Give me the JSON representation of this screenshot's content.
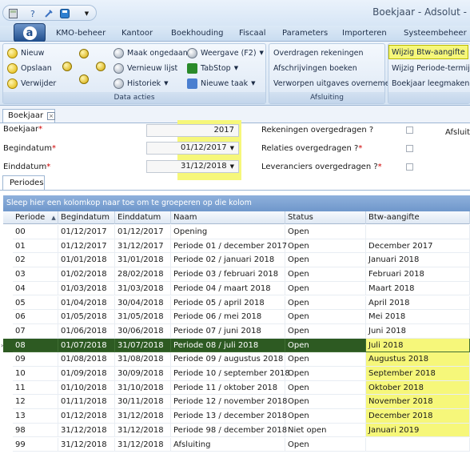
{
  "window": {
    "title": "Boekjaar - Adsolut - "
  },
  "quick_access": {
    "icons": [
      "calculator-icon",
      "help-icon",
      "tools-icon",
      "save-disk-icon"
    ]
  },
  "app_button": {
    "letter": "a"
  },
  "menu": {
    "items": [
      "KMO-beheer",
      "Kantoor",
      "Boekhouding",
      "Fiscaal",
      "Parameters",
      "Importeren",
      "Systeembeheer"
    ]
  },
  "ribbon": {
    "data_acties": {
      "label": "Data acties",
      "nieuw": "Nieuw",
      "opslaan": "Opslaan",
      "verwijder": "Verwijder",
      "maak_ongedaan": "Maak ongedaan",
      "vernieuw_lijst": "Vernieuw lijst",
      "historiek": "Historiek",
      "weergave": "Weergave (F2)",
      "tabstop": "TabStop",
      "nieuwe_taak": "Nieuwe taak"
    },
    "afsluiting": {
      "label": "Afsluiting",
      "overdragen": "Overdragen rekeningen",
      "afschrijvingen": "Afschrijvingen boeken",
      "verworpen": "Verworpen uitgaves overnemen"
    },
    "extra": {
      "wijzig_btw": "Wijzig Btw-aangifte",
      "wijzig_periode": "Wijzig Periode-termijn",
      "leegmaken": "Boekjaar leegmaken"
    }
  },
  "doc_tab": {
    "label": "Boekjaar",
    "close": "×"
  },
  "form": {
    "boekjaar_label": "Boekjaar",
    "boekjaar_value": "2017",
    "begindatum_label": "Begindatum",
    "begindatum_value": "01/12/2017",
    "einddatum_label": "Einddatum",
    "einddatum_value": "31/12/2018",
    "rekeningen_label": "Rekeningen overgedragen ?",
    "relaties_label": "Relaties overgedragen ?",
    "leveranciers_label": "Leveranciers overgedragen ?",
    "afsluiting_label": "Afsluitin",
    "required_mark": "*"
  },
  "periodes_tab": {
    "label": "Periodes"
  },
  "grid": {
    "group_hint": "Sleep hier een kolomkop naar toe om te groeperen op die kolom",
    "headers": {
      "periode": "Periode",
      "begindatum": "Begindatum",
      "einddatum": "Einddatum",
      "naam": "Naam",
      "status": "Status",
      "btw": "Btw-aangifte"
    },
    "rows": [
      {
        "periode": "00",
        "begin": "01/12/2017",
        "eind": "01/12/2017",
        "naam": "Opening",
        "status": "Open",
        "btw": ""
      },
      {
        "periode": "01",
        "begin": "01/12/2017",
        "eind": "31/12/2017",
        "naam": "Periode 01 / december 2017",
        "status": "Open",
        "btw": "December 2017"
      },
      {
        "periode": "02",
        "begin": "01/01/2018",
        "eind": "31/01/2018",
        "naam": "Periode 02 / januari 2018",
        "status": "Open",
        "btw": "Januari 2018"
      },
      {
        "periode": "03",
        "begin": "01/02/2018",
        "eind": "28/02/2018",
        "naam": "Periode 03 / februari 2018",
        "status": "Open",
        "btw": "Februari 2018"
      },
      {
        "periode": "04",
        "begin": "01/03/2018",
        "eind": "31/03/2018",
        "naam": "Periode 04 / maart 2018",
        "status": "Open",
        "btw": "Maart 2018"
      },
      {
        "periode": "05",
        "begin": "01/04/2018",
        "eind": "30/04/2018",
        "naam": "Periode 05 / april 2018",
        "status": "Open",
        "btw": "April 2018"
      },
      {
        "periode": "06",
        "begin": "01/05/2018",
        "eind": "31/05/2018",
        "naam": "Periode 06 / mei 2018",
        "status": "Open",
        "btw": "Mei 2018"
      },
      {
        "periode": "07",
        "begin": "01/06/2018",
        "eind": "30/06/2018",
        "naam": "Periode 07 / juni 2018",
        "status": "Open",
        "btw": "Juni 2018"
      },
      {
        "periode": "08",
        "begin": "01/07/2018",
        "eind": "31/07/2018",
        "naam": "Periode 08 / juli 2018",
        "status": "Open",
        "btw": "Juli 2018"
      },
      {
        "periode": "09",
        "begin": "01/08/2018",
        "eind": "31/08/2018",
        "naam": "Periode 09 / augustus 2018",
        "status": "Open",
        "btw": "Augustus 2018"
      },
      {
        "periode": "10",
        "begin": "01/09/2018",
        "eind": "30/09/2018",
        "naam": "Periode 10 / september 2018",
        "status": "Open",
        "btw": "September 2018"
      },
      {
        "periode": "11",
        "begin": "01/10/2018",
        "eind": "31/10/2018",
        "naam": "Periode 11 / oktober 2018",
        "status": "Open",
        "btw": "Oktober 2018"
      },
      {
        "periode": "12",
        "begin": "01/11/2018",
        "eind": "30/11/2018",
        "naam": "Periode 12 / november 2018",
        "status": "Open",
        "btw": "November 2018"
      },
      {
        "periode": "13",
        "begin": "01/12/2018",
        "eind": "31/12/2018",
        "naam": "Periode 13 / december 2018",
        "status": "Open",
        "btw": "December 2018"
      },
      {
        "periode": "98",
        "begin": "31/12/2018",
        "eind": "31/12/2018",
        "naam": "Periode 98 / december 2018",
        "status": "Niet open",
        "btw": "Januari 2019"
      },
      {
        "periode": "99",
        "begin": "31/12/2018",
        "eind": "31/12/2018",
        "naam": "Afsluiting",
        "status": "Open",
        "btw": ""
      }
    ],
    "selected_periode": "08"
  },
  "colors": {
    "selected_row": "#2d5a22",
    "highlight": "#f6f77a",
    "group_bar": "#7a9fd0"
  }
}
